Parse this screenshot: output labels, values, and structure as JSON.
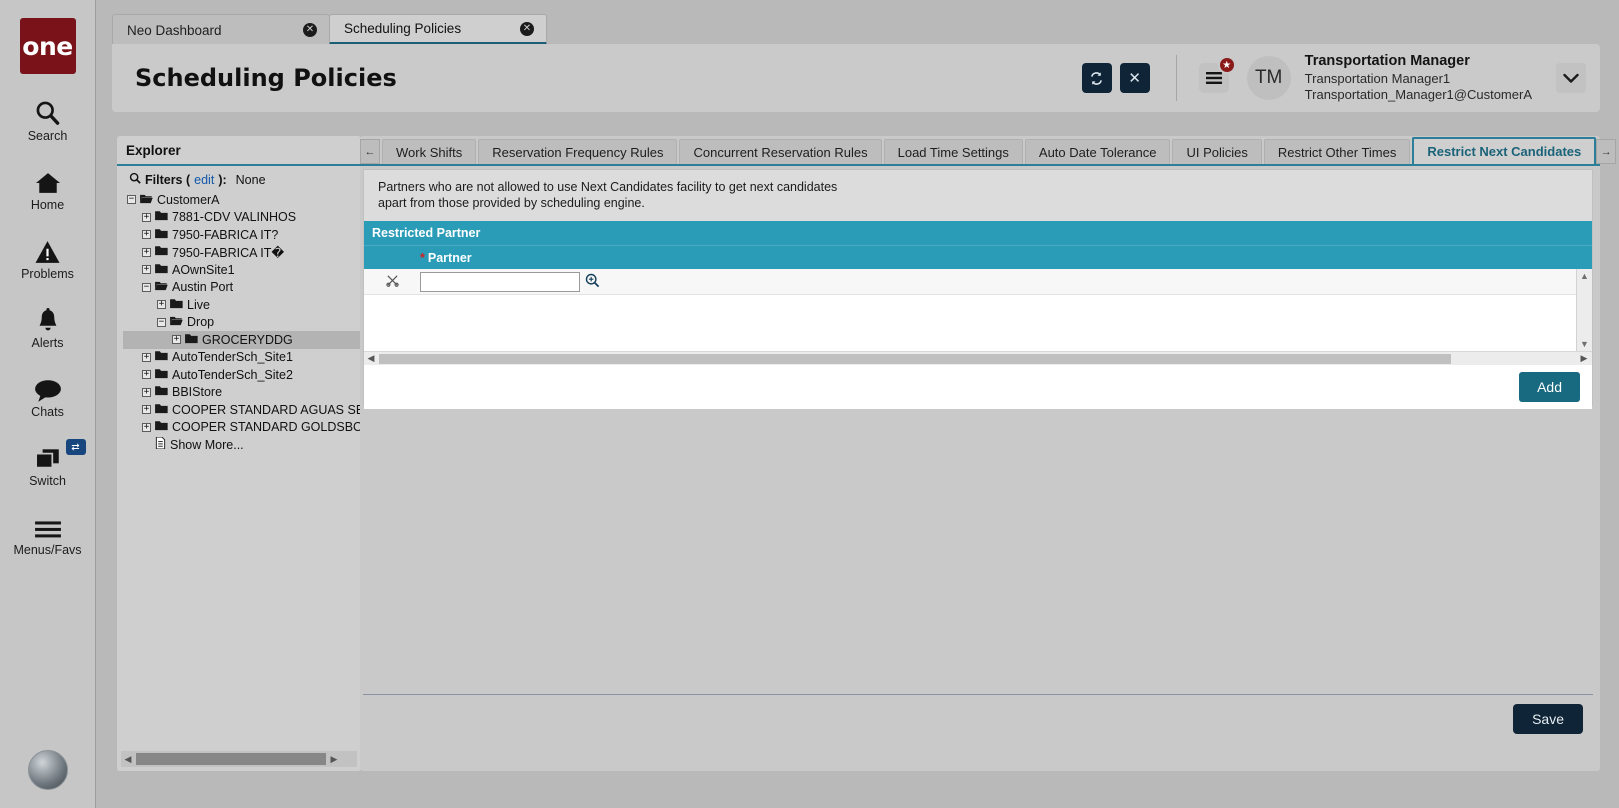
{
  "rail": {
    "logo_text": "one",
    "items": [
      {
        "label": "Search",
        "icon": "search-icon"
      },
      {
        "label": "Home",
        "icon": "home-icon"
      },
      {
        "label": "Problems",
        "icon": "warning-triangle-icon"
      },
      {
        "label": "Alerts",
        "icon": "bell-icon"
      },
      {
        "label": "Chats",
        "icon": "chat-bubble-icon"
      },
      {
        "label": "Switch",
        "icon": "windows-stack-icon",
        "badge": "⇄"
      },
      {
        "label": "Menus/Favs",
        "icon": "hamburger-icon"
      }
    ]
  },
  "tabstrip": {
    "tabs": [
      {
        "label": "Neo Dashboard",
        "active": false,
        "close": "✕"
      },
      {
        "label": "Scheduling Policies",
        "active": true,
        "close": "✕"
      }
    ]
  },
  "header": {
    "title": "Scheduling Policies",
    "refresh_icon": "↻",
    "close_icon": "✕",
    "burger_icon": "≡",
    "burger_badge": "★",
    "avatar_initials": "TM",
    "user_role": "Transportation Manager",
    "user_name": "Transportation Manager1",
    "user_email": "Transportation_Manager1@CustomerA",
    "caret_icon": "⌄"
  },
  "explorer": {
    "title": "Explorer",
    "filters_label": "Filters (",
    "filters_edit": "edit",
    "filters_suffix": "):",
    "filters_value": "None",
    "search_icon": "⌕",
    "tree": [
      {
        "label": "CustomerA",
        "depth": 0,
        "expander": "−",
        "icon": "folder-open-icon",
        "selected": false
      },
      {
        "label": "7881-CDV VALINHOS",
        "depth": 1,
        "expander": "+",
        "icon": "folder-icon",
        "selected": false
      },
      {
        "label": "7950-FABRICA IT?",
        "depth": 1,
        "expander": "+",
        "icon": "folder-icon",
        "selected": false
      },
      {
        "label": "7950-FABRICA IT�",
        "depth": 1,
        "expander": "+",
        "icon": "folder-icon",
        "selected": false
      },
      {
        "label": "AOwnSite1",
        "depth": 1,
        "expander": "+",
        "icon": "folder-icon",
        "selected": false
      },
      {
        "label": "Austin Port",
        "depth": 1,
        "expander": "−",
        "icon": "folder-open-icon",
        "selected": false
      },
      {
        "label": "Live",
        "depth": 2,
        "expander": "+",
        "icon": "folder-icon",
        "selected": false
      },
      {
        "label": "Drop",
        "depth": 2,
        "expander": "−",
        "icon": "folder-open-icon",
        "selected": false
      },
      {
        "label": "GROCERYDDG",
        "depth": 3,
        "expander": "+",
        "icon": "folder-icon",
        "selected": true
      },
      {
        "label": "AutoTenderSch_Site1",
        "depth": 1,
        "expander": "+",
        "icon": "folder-icon",
        "selected": false
      },
      {
        "label": "AutoTenderSch_Site2",
        "depth": 1,
        "expander": "+",
        "icon": "folder-icon",
        "selected": false
      },
      {
        "label": "BBIStore",
        "depth": 1,
        "expander": "+",
        "icon": "folder-icon",
        "selected": false
      },
      {
        "label": "COOPER STANDARD AGUAS SEALING (",
        "depth": 1,
        "expander": "+",
        "icon": "folder-icon",
        "selected": false
      },
      {
        "label": "COOPER STANDARD GOLDSBORO",
        "depth": 1,
        "expander": "+",
        "icon": "folder-icon",
        "selected": false
      },
      {
        "label": "Show More...",
        "depth": 1,
        "expander": "",
        "icon": "document-icon",
        "selected": false
      }
    ]
  },
  "panel": {
    "left_arrow": "←",
    "right_arrow": "→",
    "tabs": [
      {
        "label": "Work Shifts",
        "active": false
      },
      {
        "label": "Reservation Frequency Rules",
        "active": false
      },
      {
        "label": "Concurrent Reservation Rules",
        "active": false
      },
      {
        "label": "Load Time Settings",
        "active": false
      },
      {
        "label": "Auto Date Tolerance",
        "active": false
      },
      {
        "label": "UI Policies",
        "active": false
      },
      {
        "label": "Restrict Other Times",
        "active": false
      },
      {
        "label": "Restrict Next Candidates",
        "active": true
      }
    ],
    "description_line1": "Partners who are not allowed to use Next Candidates facility to get next candidates",
    "description_line2": "apart from those provided by scheduling engine.",
    "grid_title": "Restricted Partner",
    "column_required_marker": "*",
    "column_partner": "Partner",
    "row_cut_icon": "✂",
    "partner_value": "",
    "partner_placeholder": "",
    "lookup_icon": "⌕",
    "add_label": "Add",
    "save_label": "Save",
    "scroll_up": "▲",
    "scroll_down": "▼",
    "scroll_left": "◀",
    "scroll_right": "▶"
  },
  "colors": {
    "accent_teal": "#2b9cb8",
    "tab_underline": "#2d7f98",
    "dark_navy": "#0f2436",
    "add_button": "#176a7f",
    "logo_red": "#7a1219",
    "link_blue": "#1257a8"
  }
}
